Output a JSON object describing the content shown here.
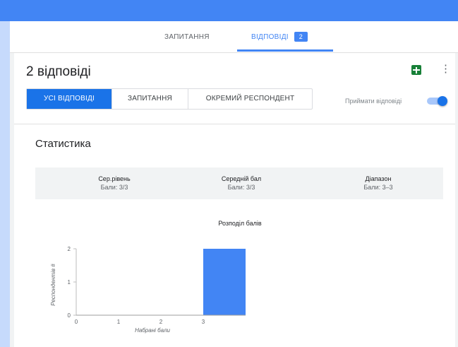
{
  "tabs": [
    {
      "label": "ЗАПИТАННЯ"
    },
    {
      "label": "ВІДПОВІДІ",
      "count": "2"
    }
  ],
  "header": {
    "title": "2 відповіді",
    "segments": [
      "УСІ ВІДПОВІДІ",
      "ЗАПИТАННЯ",
      "ОКРЕМИЙ РЕСПОНДЕНТ"
    ],
    "accept_label": "Приймати відповіді",
    "accepting": true
  },
  "stats": {
    "heading": "Статистика",
    "summary": [
      {
        "title": "Сер.рівень",
        "value": "Бали: 3/3"
      },
      {
        "title": "Середній бал",
        "value": "Бали: 3/3"
      },
      {
        "title": "Діапазон",
        "value": "Бали: 3–3"
      }
    ]
  },
  "colors": {
    "accent": "#4285f4",
    "bar": "#4285f4",
    "sheets": "#188038"
  },
  "chart_data": {
    "type": "bar",
    "title": "Розподіл балів",
    "xlabel": "Набрані бали",
    "ylabel": "Респондентів #",
    "categories": [
      "0",
      "1",
      "2",
      "3"
    ],
    "values": [
      0,
      0,
      0,
      2
    ],
    "ylim": [
      0,
      2
    ],
    "yticks": [
      "0",
      "1",
      "2"
    ],
    "grid": false
  }
}
